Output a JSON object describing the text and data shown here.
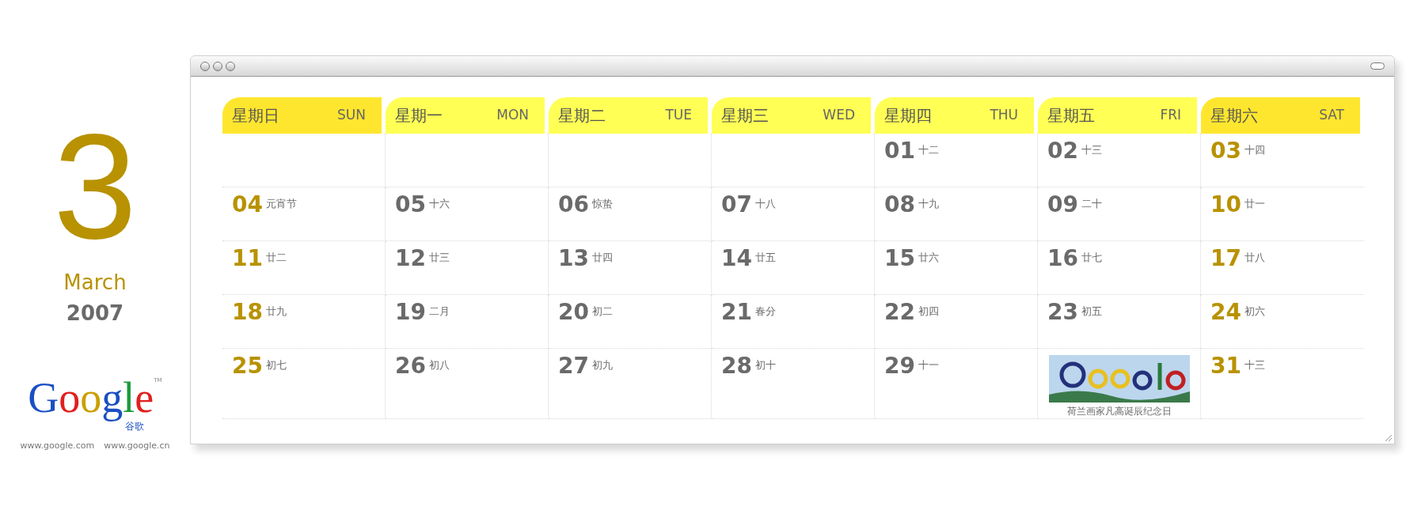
{
  "month": {
    "number": "3",
    "name": "March",
    "year": "2007"
  },
  "logo": {
    "letters": "Google",
    "tm": "TM",
    "sub": "谷歌",
    "links": [
      "www.google.com",
      "www.google.cn"
    ]
  },
  "weekdays": [
    {
      "zh": "星期日",
      "en": "SUN",
      "weekend": true
    },
    {
      "zh": "星期一",
      "en": "MON",
      "weekend": false
    },
    {
      "zh": "星期二",
      "en": "TUE",
      "weekend": false
    },
    {
      "zh": "星期三",
      "en": "WED",
      "weekend": false
    },
    {
      "zh": "星期四",
      "en": "THU",
      "weekend": false
    },
    {
      "zh": "星期五",
      "en": "FRI",
      "weekend": false
    },
    {
      "zh": "星期六",
      "en": "SAT",
      "weekend": true
    }
  ],
  "days": [
    {
      "kind": "empty"
    },
    {
      "kind": "empty"
    },
    {
      "kind": "empty"
    },
    {
      "kind": "empty"
    },
    {
      "kind": "day",
      "number": "01",
      "lunar": "十二",
      "weekend": false
    },
    {
      "kind": "day",
      "number": "02",
      "lunar": "十三",
      "weekend": false
    },
    {
      "kind": "day",
      "number": "03",
      "lunar": "十四",
      "weekend": true
    },
    {
      "kind": "day",
      "number": "04",
      "lunar": "元宵节",
      "weekend": true
    },
    {
      "kind": "day",
      "number": "05",
      "lunar": "十六",
      "weekend": false
    },
    {
      "kind": "day",
      "number": "06",
      "lunar": "惊蛰",
      "weekend": false
    },
    {
      "kind": "day",
      "number": "07",
      "lunar": "十八",
      "weekend": false
    },
    {
      "kind": "day",
      "number": "08",
      "lunar": "十九",
      "weekend": false
    },
    {
      "kind": "day",
      "number": "09",
      "lunar": "二十",
      "weekend": false
    },
    {
      "kind": "day",
      "number": "10",
      "lunar": "廿一",
      "weekend": true
    },
    {
      "kind": "day",
      "number": "11",
      "lunar": "廿二",
      "weekend": true
    },
    {
      "kind": "day",
      "number": "12",
      "lunar": "廿三",
      "weekend": false
    },
    {
      "kind": "day",
      "number": "13",
      "lunar": "廿四",
      "weekend": false
    },
    {
      "kind": "day",
      "number": "14",
      "lunar": "廿五",
      "weekend": false
    },
    {
      "kind": "day",
      "number": "15",
      "lunar": "廿六",
      "weekend": false
    },
    {
      "kind": "day",
      "number": "16",
      "lunar": "廿七",
      "weekend": false
    },
    {
      "kind": "day",
      "number": "17",
      "lunar": "廿八",
      "weekend": true
    },
    {
      "kind": "day",
      "number": "18",
      "lunar": "廿九",
      "weekend": true
    },
    {
      "kind": "day",
      "number": "19",
      "lunar": "二月",
      "weekend": false
    },
    {
      "kind": "day",
      "number": "20",
      "lunar": "初二",
      "weekend": false
    },
    {
      "kind": "day",
      "number": "21",
      "lunar": "春分",
      "weekend": false
    },
    {
      "kind": "day",
      "number": "22",
      "lunar": "初四",
      "weekend": false
    },
    {
      "kind": "day",
      "number": "23",
      "lunar": "初五",
      "weekend": false
    },
    {
      "kind": "day",
      "number": "24",
      "lunar": "初六",
      "weekend": true
    },
    {
      "kind": "day",
      "number": "25",
      "lunar": "初七",
      "weekend": true
    },
    {
      "kind": "day",
      "number": "26",
      "lunar": "初八",
      "weekend": false
    },
    {
      "kind": "day",
      "number": "27",
      "lunar": "初九",
      "weekend": false
    },
    {
      "kind": "day",
      "number": "28",
      "lunar": "初十",
      "weekend": false
    },
    {
      "kind": "day",
      "number": "29",
      "lunar": "十一",
      "weekend": false
    },
    {
      "kind": "doodle",
      "caption": "荷兰画家凡高诞辰纪念日"
    },
    {
      "kind": "day",
      "number": "31",
      "lunar": "十三",
      "weekend": true
    }
  ]
}
